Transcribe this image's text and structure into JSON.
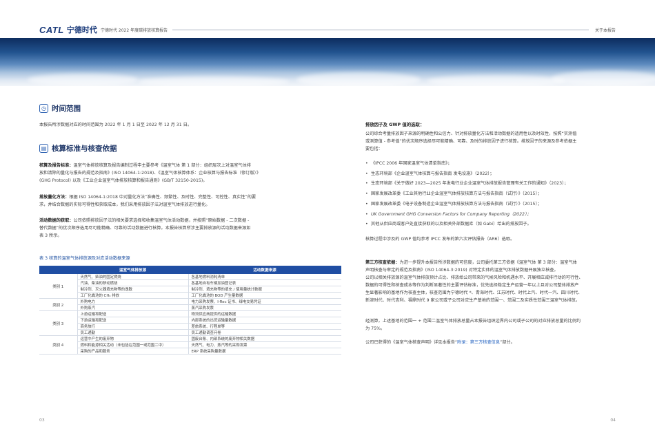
{
  "header": {
    "logo_en": "CATL",
    "logo_cn": "宁德时代",
    "doc_title": "宁德时代 2022 年度碳排放核算报告",
    "section_name": "关于本报告"
  },
  "time_scope": {
    "title": "时间范围",
    "text": "本报告所涉数据对应的时间范围为 2022 年 1 月 1 日至 2022 年 12 月 31 日。"
  },
  "standards": {
    "title": "核算标准与核查依据",
    "p1_label": "核算及报告标准：",
    "p1_lines": [
      "温室气体排放核算及报告编制过程中主要参考《温室气体  第 1 部分：组织层次上对温室气体排",
      "放和清除的量化与报告的规范及指南》(ISO 14064-1:2018)、《温室气体核算体系：企业核算与报告标准（修订版）》",
      "(GHG Protocol) 以及《工业企业温室气体排放核算和报告通则》(GB/T 32150-2015)。"
    ],
    "p2_label": "排放量化方法：",
    "p2_lines": [
      "根据 ISO 14064-1:2018 中对量化方法“准确性、频繁性、及时性、完整性、可控性、真实性”的要",
      "求，并结合数据的实际可得性和获取成本，我们采用排放因子法对温室气体排放进行量化。"
    ],
    "p3_label": "活动数据的获取：",
    "p3_lines": [
      "公司依照排放因子法的相关要求选择和收集温室气体活动数据，并按照“原始数据 - 二次数据 -",
      "替代数据”的优次顺序选用尽可能精确、可靠的活动数据进行核算。本报告核算所涉主要排放源的活动数据来源如",
      "表 3 所示。"
    ]
  },
  "table": {
    "caption": "表 3 核算的温室气体排放源及对应活动数据来源",
    "headers": [
      "温室气体排放源",
      "活动数据来源"
    ],
    "groups": [
      {
        "category": "类别 1",
        "rows": [
          [
            "天然气、柴油的固定燃烧",
            "各基地燃料消耗清单"
          ],
          [
            "汽油、柴油的移动燃烧",
            "各基地自有车辆加油登记表"
          ],
          [
            "制冷剂、灭火器填充物等的逸散",
            "制冷剂、填充物等的填充 / 使用量统计数据"
          ],
          [
            "工厂化粪池的 CH₄ 排放",
            "工厂化粪池的 BOD 产生量数据"
          ]
        ]
      },
      {
        "category": "类别 2",
        "rows": [
          [
            "外购电力",
            "电力采购发票、I-Rec 证书、绿电交易凭证"
          ],
          [
            "外购蒸汽",
            "蒸汽采购发票"
          ]
        ]
      },
      {
        "category": "类别 3",
        "rows": [
          [
            "上游运输和配送",
            "物流供应商提供的运输数据"
          ],
          [
            "下游运输和配送",
            "内部系统的出货运输量数据"
          ],
          [
            "商务旅行",
            "差旅系统、行程单等"
          ],
          [
            "员工通勤",
            "员工通勤调查问卷"
          ]
        ]
      },
      {
        "category": "类别 4",
        "rows": [
          [
            "运营中产生的废弃物",
            "固废台账、内部系统的废弃物相关数据"
          ],
          [
            "燃料和能源相关活动（未包括在范围一或范围二中）",
            "天然气、电力、蒸汽等的采购发票"
          ],
          [
            "采购的产品和服务",
            "ERP 系统采购量数据"
          ]
        ]
      }
    ]
  },
  "right": {
    "ef_title": "排放因子及 GWP 值的选取：",
    "ef_lines": [
      "公司综合考量排放因子来源的明确性和公信力、针对排放量化方法和活动数据的适用性以及时效性，按照“实测值",
      "或测算值 - 参考值”的优次顺序选择尽可能精确、可靠、及时的排放因子进行核算。排放因子的来源及参考依据主",
      "要包括："
    ],
    "ef_list": [
      "《IPCC 2006 年国家温室气体清单指南》；",
      "生态环境部《企业温室气体核算与报告指南 发电设施》（2022）；",
      "生态环境部《关于做好 2023—2025 年发电行业企业温室气体排放报告管理有关工作的通知》（2023）；",
      "国家发展改革委《工业其他行业企业温室气体排放核算方法与报告指南（试行）》（2015）；",
      "国家发展改革委《电子设备制造企业温室气体排放核算方法与报告指南（试行）》（2015）；",
      "UK Government GHG Conversion Factors for Company Reporting（2022）；",
      "其他从供应商或客户处直接获取的以及相关外部数据库（如 Gabi）给出的排放因子。"
    ],
    "gwp_line": "核算过程中涉及的 GWP 值均参考 IPCC 发布的第六次评估报告（AR6）选取。",
    "tp_label": "第三方核查依据：",
    "tp_lines_first": "为进一步提升本报告所涉数据的可信度，公司委托第三方依据《温室气体  第 3 部分：温室气体",
    "tp_lines": [
      "声明核查与审定的规范及指南》(ISO  14064-3:2019) 对特定实体的温室气体排放数据开展独立核查。",
      "公司以相关排放源的温室气体排放预计占比、排放给公司带来的气候风险和机遇水平、开展相应减排行动的可行性、",
      "数据的可得性和核查成本等作为判断显著性的主要评估标准，优先选择稳定生产运营一年以上且对公司整体排放产",
      "生显著影响的基地作为核查主体，核查范围为宁德时代 *、青海时代、江苏时代、时代上汽、时代一汽、四川时代、",
      "新津时代、时代吉利、福鼎时代 9 家公司或子公司对应生产基地的范围一、范围二及实质性范围三温室气体排放。"
    ],
    "tp_p2_lines": [
      "经测算，上述基地的范围一 + 范围二温室气体排放总量占本报告组织边界内公司或子公司的对应排放总量的比例约",
      "为 75%。"
    ],
    "tp_p3_pre": "公司已获得的《温室气体核查声明》详见本报告“",
    "tp_p3_link": "附录：第三方核查信息",
    "tp_p3_post": "”部分。"
  },
  "footer": {
    "left_page": "03",
    "right_page": "04"
  }
}
